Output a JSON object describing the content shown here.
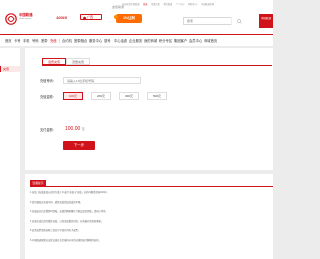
{
  "header": {
    "logo_name": "中国联通",
    "logo_sub": "China unicom",
    "hotline": "10010",
    "city": "广西",
    "promo_top": "金色联通",
    "promo_main": "1%让利",
    "top_links": [
      "欢迎来到中国联通",
      "登录",
      "免费注册",
      "我的联通",
      "个人中心",
      "购物车(0)",
      "中国联通官网"
    ],
    "search_placeholder": "搜索",
    "right_box": "中国联通"
  },
  "nav": {
    "items": [
      "首页",
      "卡号",
      "手机",
      "号码",
      "宽带",
      "充值",
      "合约机",
      "宽带融合",
      "服务中心",
      "靓号",
      "中心话费",
      "企业服务",
      "我的商城",
      "积分专区",
      "集团客户",
      "会员中心",
      "商城首页"
    ],
    "active_index": 5
  },
  "sidebar": {
    "active_label": "充值"
  },
  "form": {
    "tabs": [
      "话费充值",
      "流量充值"
    ],
    "phone_label": "充值号码：",
    "phone_placeholder": "请输入11位手机号码",
    "amount_label": "充值金额：",
    "amounts": [
      "100元",
      "200元",
      "300元",
      "500元"
    ],
    "selected_amount_index": 0,
    "pay_label": "支付金额：",
    "pay_amount": "100.00",
    "pay_unit": "元",
    "next_button": "下一步"
  },
  "notice": {
    "title": "温馨提示",
    "lines": [
      "1.充值【充值面值以实际为准】不支持“充值卡”充值，如有问题请咨询10010。",
      "2.请仔细核对充值号码，避免充值错误造成的不便。",
      "3.充值成功后话费即时到账，如遇到网络繁忙可能会延迟到账，请耐心等待。",
      "4.充值完成后请勿重复充值，以免造成重复扣款，如有疑问请咨询客服。",
      "5.如需发票请登录网上营业厅申请开具电子发票。",
      "6.中国联通保留在法律法规允许范围内对本活动规则进行解释的权利。"
    ]
  },
  "colors": {
    "brand_red": "#d0131a",
    "promo_orange": "#ff6b00"
  }
}
